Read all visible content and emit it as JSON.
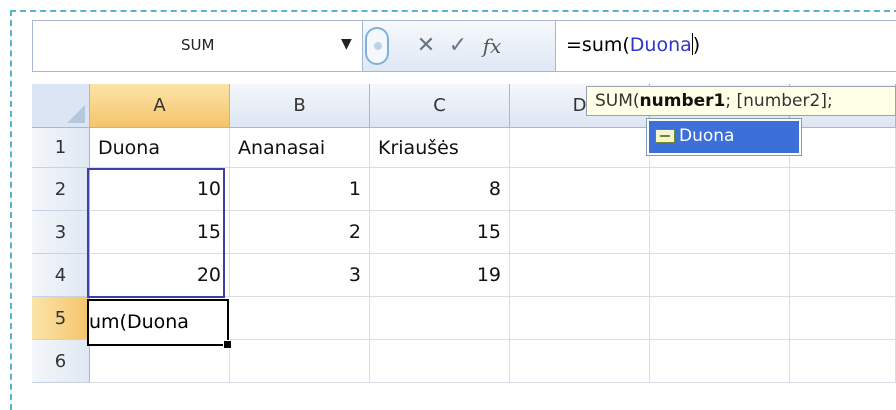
{
  "name_box": {
    "value": "SUM"
  },
  "formula_bar": {
    "cancel_glyph": "✕",
    "enter_glyph": "✓",
    "fx_label": "fx",
    "formula_prefix": "=sum(",
    "formula_ref": "Duona",
    "formula_suffix": ")"
  },
  "columns": [
    "A",
    "B",
    "C",
    "D"
  ],
  "rows": [
    "1",
    "2",
    "3",
    "4",
    "5",
    "6"
  ],
  "cells": {
    "A1": "Duona",
    "B1": "Ananasai",
    "C1": "Kriaušės",
    "A2": "10",
    "B2": "1",
    "C2": "8",
    "A3": "15",
    "B3": "2",
    "C3": "15",
    "A4": "20",
    "B4": "3",
    "C4": "19",
    "A5": "um(Duona"
  },
  "tooltip": {
    "func": "SUM(",
    "arg1": "number1",
    "rest": "; [number2];"
  },
  "autocomplete": {
    "items": [
      "Duona"
    ]
  },
  "colors": {
    "accent": "#3d6fd8",
    "range_border": "#3f3faa",
    "frame": "#57b3cf"
  }
}
